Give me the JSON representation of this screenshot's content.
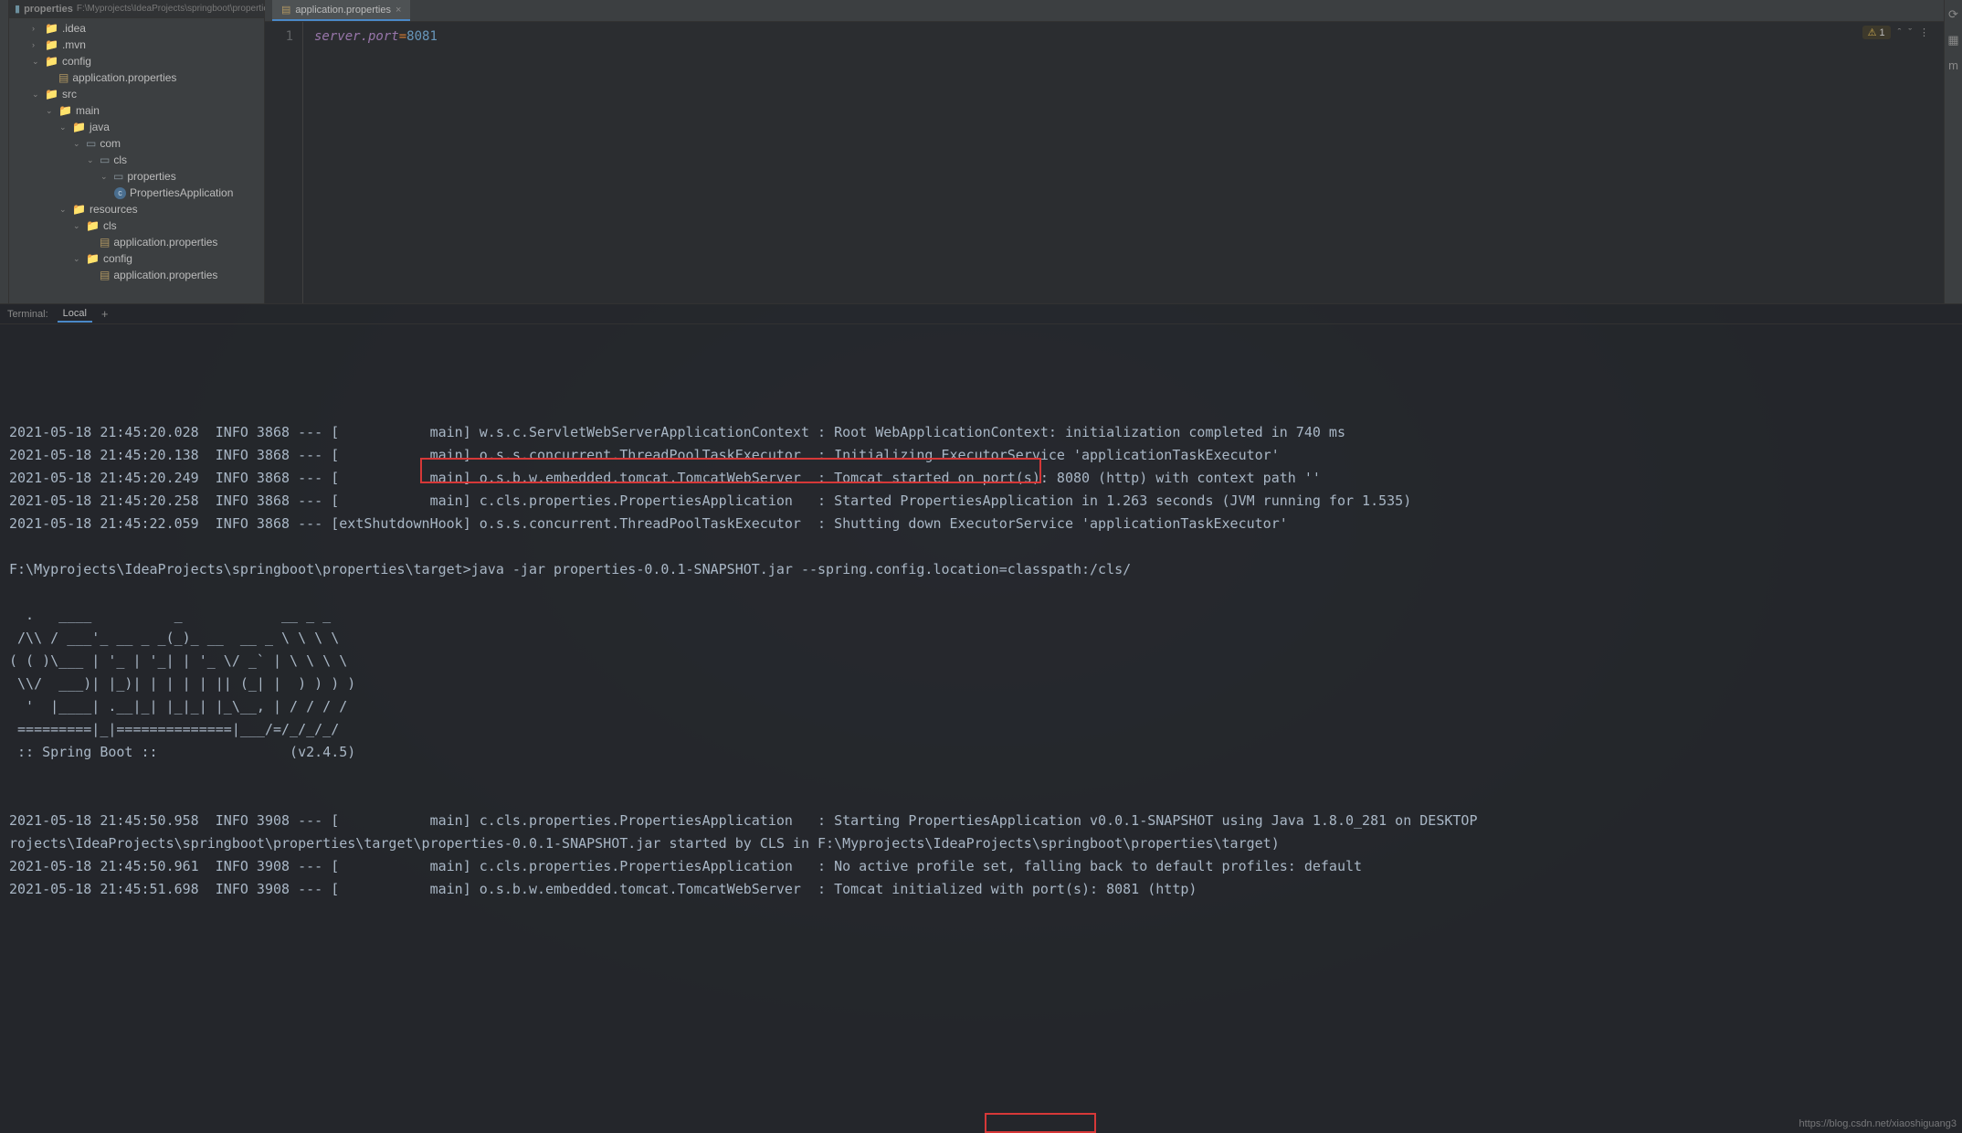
{
  "breadcrumb": {
    "project": "properties",
    "path": "F:\\Myprojects\\IdeaProjects\\springboot\\properties"
  },
  "tree": {
    "idea": ".idea",
    "mvn": ".mvn",
    "config": "config",
    "config_app_props": "application.properties",
    "src": "src",
    "main": "main",
    "java": "java",
    "com": "com",
    "cls": "cls",
    "properties": "properties",
    "propsApp": "PropertiesApplication",
    "resources": "resources",
    "res_cls": "cls",
    "res_cls_app": "application.properties",
    "res_config": "config",
    "res_config_app": "application.properties"
  },
  "editor": {
    "tab_label": "application.properties",
    "line_number": "1",
    "code_key": "server.port",
    "code_eq": "=",
    "code_val": "8081",
    "warning_count": "1"
  },
  "terminal": {
    "title": "Terminal:",
    "tab_local": "Local",
    "lines": [
      "2021-05-18 21:45:20.028  INFO 3868 --- [           main] w.s.c.ServletWebServerApplicationContext : Root WebApplicationContext: initialization completed in 740 ms",
      "2021-05-18 21:45:20.138  INFO 3868 --- [           main] o.s.s.concurrent.ThreadPoolTaskExecutor  : Initializing ExecutorService 'applicationTaskExecutor'",
      "2021-05-18 21:45:20.249  INFO 3868 --- [           main] o.s.b.w.embedded.tomcat.TomcatWebServer  : Tomcat started on port(s): 8080 (http) with context path ''",
      "2021-05-18 21:45:20.258  INFO 3868 --- [           main] c.cls.properties.PropertiesApplication   : Started PropertiesApplication in 1.263 seconds (JVM running for 1.535)",
      "2021-05-18 21:45:22.059  INFO 3868 --- [extShutdownHook] o.s.s.concurrent.ThreadPoolTaskExecutor  : Shutting down ExecutorService 'applicationTaskExecutor'",
      "",
      "F:\\Myprojects\\IdeaProjects\\springboot\\properties\\target>java -jar properties-0.0.1-SNAPSHOT.jar --spring.config.location=classpath:/cls/",
      "",
      "  .   ____          _            __ _ _",
      " /\\\\ / ___'_ __ _ _(_)_ __  __ _ \\ \\ \\ \\",
      "( ( )\\___ | '_ | '_| | '_ \\/ _` | \\ \\ \\ \\",
      " \\\\/  ___)| |_)| | | | | || (_| |  ) ) ) )",
      "  '  |____| .__|_| |_|_| |_\\__, | / / / /",
      " =========|_|==============|___/=/_/_/_/",
      " :: Spring Boot ::                (v2.4.5)",
      "",
      "",
      "2021-05-18 21:45:50.958  INFO 3908 --- [           main] c.cls.properties.PropertiesApplication   : Starting PropertiesApplication v0.0.1-SNAPSHOT using Java 1.8.0_281 on DESKTOP",
      "rojects\\IdeaProjects\\springboot\\properties\\target\\properties-0.0.1-SNAPSHOT.jar started by CLS in F:\\Myprojects\\IdeaProjects\\springboot\\properties\\target)",
      "2021-05-18 21:45:50.961  INFO 3908 --- [           main] c.cls.properties.PropertiesApplication   : No active profile set, falling back to default profiles: default",
      "2021-05-18 21:45:51.698  INFO 3908 --- [           main] o.s.b.w.embedded.tomcat.TomcatWebServer  : Tomcat initialized with port(s): 8081 (http)"
    ]
  },
  "watermark": "https://blog.csdn.net/xiaoshiguang3"
}
